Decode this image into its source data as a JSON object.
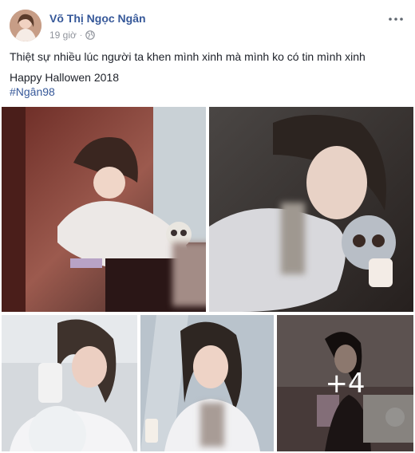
{
  "post": {
    "author": "Võ Thị Ngọc Ngân",
    "time": "19 giờ",
    "privacy_icon": "globe-icon",
    "more_icon": "more-options-icon",
    "text_line_1": "Thiệt sự nhiều lúc người ta khen mình xinh mà mình ko có tin mình xinh",
    "text_line_2": "Happy Hallowen 2018",
    "hashtag": "#Ngân98",
    "extra_photos": "+4"
  },
  "colors": {
    "link": "#365899",
    "meta": "#90949c",
    "text": "#1d2129"
  }
}
